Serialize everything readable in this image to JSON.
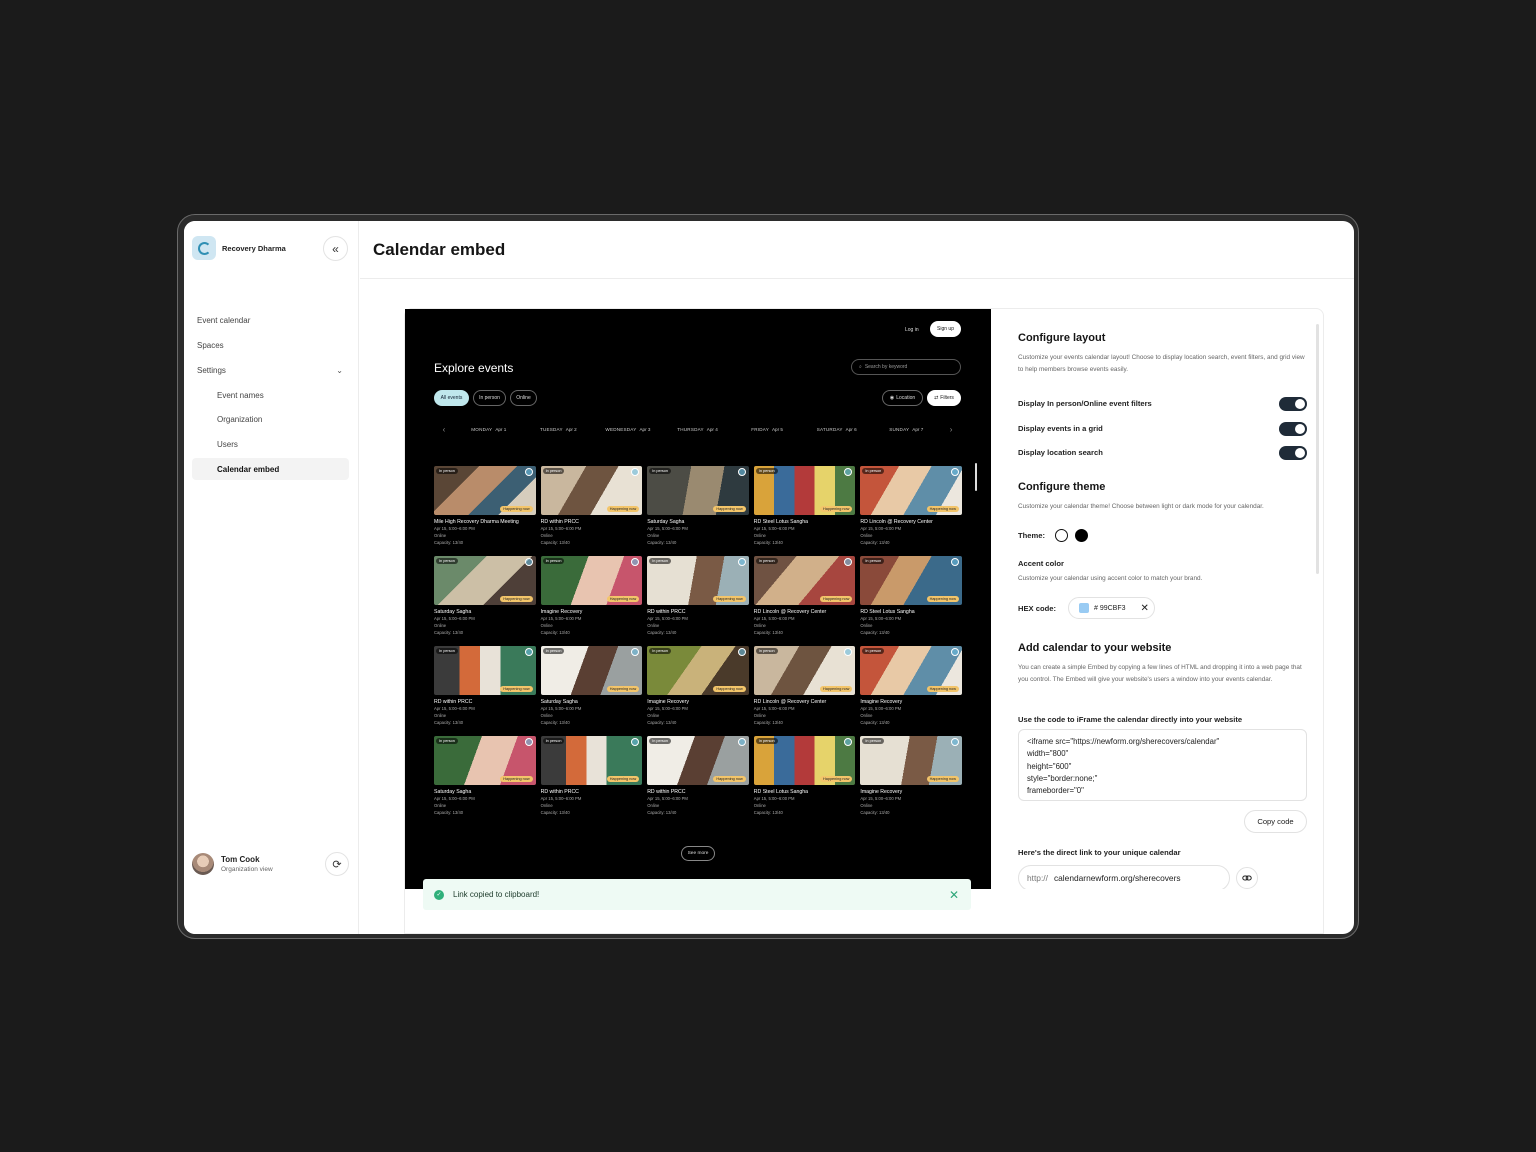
{
  "sidebar": {
    "brand": "Recovery Dharma",
    "items": [
      {
        "label": "Event calendar"
      },
      {
        "label": "Spaces"
      },
      {
        "label": "Settings"
      },
      {
        "label": "Event names"
      },
      {
        "label": "Organization"
      },
      {
        "label": "Users"
      },
      {
        "label": "Calendar embed"
      }
    ],
    "user": {
      "name": "Tom Cook",
      "role": "Organization view"
    }
  },
  "header": {
    "title": "Calendar embed"
  },
  "preview": {
    "login": "Log in",
    "signup": "Sign up",
    "title": "Explore events",
    "search_placeholder": "Search by keyword",
    "filters": [
      "All events",
      "In person",
      "Online"
    ],
    "location": "Location",
    "filters_btn": "Filters",
    "days": [
      {
        "name": "MONDAY",
        "date": "Apr 1"
      },
      {
        "name": "TUESDAY",
        "date": "Apr 2"
      },
      {
        "name": "WEDNESDAY",
        "date": "Apr 3"
      },
      {
        "name": "THURSDAY",
        "date": "Apr 4"
      },
      {
        "name": "FRIDAY",
        "date": "Apr 5"
      },
      {
        "name": "SATURDAY",
        "date": "Apr 6"
      },
      {
        "name": "SUNDAY",
        "date": "Apr 7"
      }
    ],
    "tag": "In person",
    "live": "Happening now",
    "time": "Apr 15, 5:00–6:00 PM",
    "mode": "Online",
    "capacity": "Capacity: 13/40",
    "events": [
      {
        "name": "Mile High Recovery Dharma Meeting"
      },
      {
        "name": "RD within PRCC"
      },
      {
        "name": "Saturday Sagha"
      },
      {
        "name": "RD Steel Lotus Sangha"
      },
      {
        "name": "RD Lincoln @ Recovery Center"
      },
      {
        "name": "Saturday Sagha"
      },
      {
        "name": "Imagine Recovery"
      },
      {
        "name": "RD within PRCC"
      },
      {
        "name": "RD Lincoln @ Recovery Center"
      },
      {
        "name": "RD Steel Lotus Sangha"
      },
      {
        "name": "RD within PRCC"
      },
      {
        "name": "Saturday Sagha"
      },
      {
        "name": "Imagine Recovery"
      },
      {
        "name": "RD Lincoln @ Recovery Center"
      },
      {
        "name": "Imagine Recovery"
      },
      {
        "name": "Saturday Sagha"
      },
      {
        "name": "RD within PRCC"
      },
      {
        "name": "RD within PRCC"
      },
      {
        "name": "RD Steel Lotus Sangha"
      },
      {
        "name": "Imagine Recovery"
      }
    ],
    "see_more": "See more"
  },
  "config": {
    "layout_title": "Configure layout",
    "layout_desc": "Customize your events calendar layout! Choose to display location search, event filters, and grid view to help members browse events easily.",
    "toggles": [
      {
        "label": "Display In person/Online event filters",
        "on": true
      },
      {
        "label": "Display events in a grid",
        "on": true
      },
      {
        "label": "Display location search",
        "on": true
      }
    ],
    "theme_title": "Configure theme",
    "theme_desc": "Customize your calendar theme! Choose between light or dark mode for your calendar.",
    "theme_label": "Theme:",
    "accent_label": "Accent color",
    "accent_desc": "Customize your calendar using accent color to match your brand.",
    "hex_label": "HEX code:",
    "hex_value": "# 99CBF3",
    "accent_color": "#99CBF3",
    "website_title": "Add calendar to your website",
    "website_desc": "You can create a simple Embed by copying a few lines of HTML and dropping it into a web page that you control. The Embed will give your website's users a window into your events calendar.",
    "iframe_label": "Use the code to iFrame the calendar directly into your website",
    "code": "<iframe src=\"https://newform.org/sherecovers/calendar\"\nwidth=\"800\"\nheight=\"600\"\nstyle=\"border:none;\"\nframeborder=\"0\"",
    "copy_label": "Copy code",
    "link_label": "Here's the direct link to your unique calendar",
    "url_prefix": "http://",
    "url_value": "calendarnewform.org/sherecovers"
  },
  "toast": {
    "message": "Link copied to clipboard!"
  }
}
